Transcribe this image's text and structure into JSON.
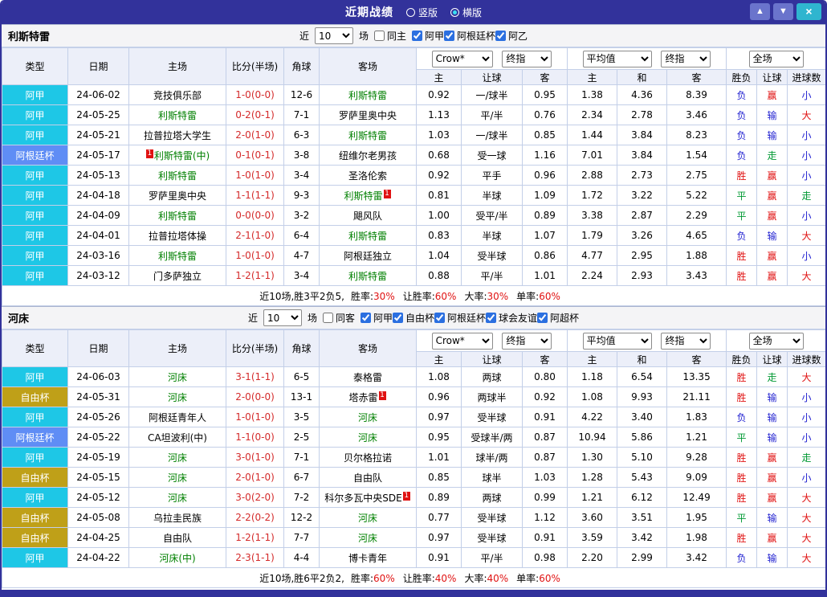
{
  "titlebar": {
    "title": "近期战绩",
    "layout_options": [
      {
        "label": "竖版",
        "selected": false
      },
      {
        "label": "横版",
        "selected": true
      }
    ],
    "up_icon": "▲",
    "down_icon": "▼",
    "close_icon": "×"
  },
  "filter_labels": {
    "recent": "近",
    "games": "场"
  },
  "columns": {
    "type": "类型",
    "date": "日期",
    "home": "主场",
    "score": "比分(半场)",
    "corner": "角球",
    "away": "客场",
    "odds_group1": {
      "select1": "Crow*",
      "select2": "终指",
      "sub": [
        "主",
        "让球",
        "客"
      ]
    },
    "odds_group2": {
      "select1": "平均值",
      "select2": "终指",
      "sub": [
        "主",
        "和",
        "客"
      ]
    },
    "result_group": {
      "select": "全场",
      "sub": [
        "胜负",
        "让球",
        "进球数"
      ]
    }
  },
  "league_colors": {
    "阿甲": "#1ec7e6",
    "阿根廷杯": "#5f8df5",
    "自由杯": "#bfa018"
  },
  "result_colors": {
    "胜": "#e01212",
    "赢": "#e01212",
    "大": "#e01212",
    "负": "#1f1fd0",
    "输": "#1f1fd0",
    "小": "#1f1fd0",
    "平": "#009933",
    "走": "#009933"
  },
  "sections": [
    {
      "team": "利斯特雷",
      "filter": {
        "count": "10",
        "same_label": "同主",
        "leagues": [
          "阿甲",
          "阿根廷杯",
          "阿乙"
        ]
      },
      "rows": [
        {
          "league": "阿甲",
          "date": "24-06-02",
          "home": {
            "name": "竞技俱乐部"
          },
          "score": "1-0(0-0)",
          "corner": "12-6",
          "away": {
            "name": "利斯特雷",
            "focus": true
          },
          "odds": [
            "0.92",
            "一/球半",
            "0.95"
          ],
          "avg": [
            "1.38",
            "4.36",
            "8.39"
          ],
          "results": [
            "负",
            "赢",
            "小"
          ]
        },
        {
          "league": "阿甲",
          "date": "24-05-25",
          "home": {
            "name": "利斯特雷",
            "focus": true
          },
          "score": "0-2(0-1)",
          "corner": "7-1",
          "away": {
            "name": "罗萨里奥中央"
          },
          "odds": [
            "1.13",
            "平/半",
            "0.76"
          ],
          "avg": [
            "2.34",
            "2.78",
            "3.46"
          ],
          "results": [
            "负",
            "输",
            "大"
          ]
        },
        {
          "league": "阿甲",
          "date": "24-05-21",
          "home": {
            "name": "拉普拉塔大学生"
          },
          "score": "2-0(1-0)",
          "corner": "6-3",
          "away": {
            "name": "利斯特雷",
            "focus": true
          },
          "odds": [
            "1.03",
            "一/球半",
            "0.85"
          ],
          "avg": [
            "1.44",
            "3.84",
            "8.23"
          ],
          "results": [
            "负",
            "输",
            "小"
          ]
        },
        {
          "league": "阿根廷杯",
          "date": "24-05-17",
          "home": {
            "name": "利斯特雷(中)",
            "focus": true,
            "badge": "1",
            "badge_pos": "before"
          },
          "score": "0-1(0-1)",
          "corner": "3-8",
          "away": {
            "name": "纽维尔老男孩"
          },
          "odds": [
            "0.68",
            "受一球",
            "1.16"
          ],
          "avg": [
            "7.01",
            "3.84",
            "1.54"
          ],
          "results": [
            "负",
            "走",
            "小"
          ]
        },
        {
          "league": "阿甲",
          "date": "24-05-13",
          "home": {
            "name": "利斯特雷",
            "focus": true
          },
          "score": "1-0(1-0)",
          "corner": "3-4",
          "away": {
            "name": "圣洛伦索"
          },
          "odds": [
            "0.92",
            "平手",
            "0.96"
          ],
          "avg": [
            "2.88",
            "2.73",
            "2.75"
          ],
          "results": [
            "胜",
            "赢",
            "小"
          ]
        },
        {
          "league": "阿甲",
          "date": "24-04-18",
          "home": {
            "name": "罗萨里奥中央"
          },
          "score": "1-1(1-1)",
          "corner": "9-3",
          "away": {
            "name": "利斯特雷",
            "focus": true,
            "badge": "1",
            "badge_pos": "after"
          },
          "odds": [
            "0.81",
            "半球",
            "1.09"
          ],
          "avg": [
            "1.72",
            "3.22",
            "5.22"
          ],
          "results": [
            "平",
            "赢",
            "走"
          ]
        },
        {
          "league": "阿甲",
          "date": "24-04-09",
          "home": {
            "name": "利斯特雷",
            "focus": true
          },
          "score": "0-0(0-0)",
          "corner": "3-2",
          "away": {
            "name": "飓风队"
          },
          "odds": [
            "1.00",
            "受平/半",
            "0.89"
          ],
          "avg": [
            "3.38",
            "2.87",
            "2.29"
          ],
          "results": [
            "平",
            "赢",
            "小"
          ]
        },
        {
          "league": "阿甲",
          "date": "24-04-01",
          "home": {
            "name": "拉普拉塔体操"
          },
          "score": "2-1(1-0)",
          "corner": "6-4",
          "away": {
            "name": "利斯特雷",
            "focus": true
          },
          "odds": [
            "0.83",
            "半球",
            "1.07"
          ],
          "avg": [
            "1.79",
            "3.26",
            "4.65"
          ],
          "results": [
            "负",
            "输",
            "大"
          ]
        },
        {
          "league": "阿甲",
          "date": "24-03-16",
          "home": {
            "name": "利斯特雷",
            "focus": true
          },
          "score": "1-0(1-0)",
          "corner": "4-7",
          "away": {
            "name": "阿根廷独立"
          },
          "odds": [
            "1.04",
            "受半球",
            "0.86"
          ],
          "avg": [
            "4.77",
            "2.95",
            "1.88"
          ],
          "results": [
            "胜",
            "赢",
            "小"
          ]
        },
        {
          "league": "阿甲",
          "date": "24-03-12",
          "home": {
            "name": "门多萨独立"
          },
          "score": "1-2(1-1)",
          "corner": "3-4",
          "away": {
            "name": "利斯特雷",
            "focus": true
          },
          "odds": [
            "0.88",
            "平/半",
            "1.01"
          ],
          "avg": [
            "2.24",
            "2.93",
            "3.43"
          ],
          "results": [
            "胜",
            "赢",
            "大"
          ]
        }
      ],
      "summary": {
        "prefix": "近10场,胜3平2负5,",
        "stats": [
          {
            "label": "胜率:",
            "value": "30%"
          },
          {
            "label": "让胜率:",
            "value": "60%"
          },
          {
            "label": "大率:",
            "value": "30%"
          },
          {
            "label": "单率:",
            "value": "60%"
          }
        ]
      }
    },
    {
      "team": "河床",
      "filter": {
        "count": "10",
        "same_label": "同客",
        "leagues": [
          "阿甲",
          "自由杯",
          "阿根廷杯",
          "球会友谊",
          "阿超杯"
        ]
      },
      "rows": [
        {
          "league": "阿甲",
          "date": "24-06-03",
          "home": {
            "name": "河床",
            "focus": true
          },
          "score": "3-1(1-1)",
          "corner": "6-5",
          "away": {
            "name": "泰格雷"
          },
          "odds": [
            "1.08",
            "两球",
            "0.80"
          ],
          "avg": [
            "1.18",
            "6.54",
            "13.35"
          ],
          "results": [
            "胜",
            "走",
            "大"
          ]
        },
        {
          "league": "自由杯",
          "date": "24-05-31",
          "home": {
            "name": "河床",
            "focus": true
          },
          "score": "2-0(0-0)",
          "corner": "13-1",
          "away": {
            "name": "塔赤雷",
            "badge": "1",
            "badge_pos": "after"
          },
          "odds": [
            "0.96",
            "两球半",
            "0.92"
          ],
          "avg": [
            "1.08",
            "9.93",
            "21.11"
          ],
          "results": [
            "胜",
            "输",
            "小"
          ]
        },
        {
          "league": "阿甲",
          "date": "24-05-26",
          "home": {
            "name": "阿根廷青年人"
          },
          "score": "1-0(1-0)",
          "corner": "3-5",
          "away": {
            "name": "河床",
            "focus": true
          },
          "odds": [
            "0.97",
            "受半球",
            "0.91"
          ],
          "avg": [
            "4.22",
            "3.40",
            "1.83"
          ],
          "results": [
            "负",
            "输",
            "小"
          ]
        },
        {
          "league": "阿根廷杯",
          "date": "24-05-22",
          "home": {
            "name": "CA坦波利(中)"
          },
          "score": "1-1(0-0)",
          "corner": "2-5",
          "away": {
            "name": "河床",
            "focus": true
          },
          "odds": [
            "0.95",
            "受球半/两",
            "0.87"
          ],
          "avg": [
            "10.94",
            "5.86",
            "1.21"
          ],
          "results": [
            "平",
            "输",
            "小"
          ]
        },
        {
          "league": "阿甲",
          "date": "24-05-19",
          "home": {
            "name": "河床",
            "focus": true
          },
          "score": "3-0(1-0)",
          "corner": "7-1",
          "away": {
            "name": "贝尔格拉诺"
          },
          "odds": [
            "1.01",
            "球半/两",
            "0.87"
          ],
          "avg": [
            "1.30",
            "5.10",
            "9.28"
          ],
          "results": [
            "胜",
            "赢",
            "走"
          ]
        },
        {
          "league": "自由杯",
          "date": "24-05-15",
          "home": {
            "name": "河床",
            "focus": true
          },
          "score": "2-0(1-0)",
          "corner": "6-7",
          "away": {
            "name": "自由队"
          },
          "odds": [
            "0.85",
            "球半",
            "1.03"
          ],
          "avg": [
            "1.28",
            "5.43",
            "9.09"
          ],
          "results": [
            "胜",
            "赢",
            "小"
          ]
        },
        {
          "league": "阿甲",
          "date": "24-05-12",
          "home": {
            "name": "河床",
            "focus": true
          },
          "score": "3-0(2-0)",
          "corner": "7-2",
          "away": {
            "name": "科尔多瓦中央SDE",
            "badge": "1",
            "badge_pos": "after"
          },
          "odds": [
            "0.89",
            "两球",
            "0.99"
          ],
          "avg": [
            "1.21",
            "6.12",
            "12.49"
          ],
          "results": [
            "胜",
            "赢",
            "大"
          ]
        },
        {
          "league": "自由杯",
          "date": "24-05-08",
          "home": {
            "name": "乌拉圭民族"
          },
          "score": "2-2(0-2)",
          "corner": "12-2",
          "away": {
            "name": "河床",
            "focus": true
          },
          "odds": [
            "0.77",
            "受半球",
            "1.12"
          ],
          "avg": [
            "3.60",
            "3.51",
            "1.95"
          ],
          "results": [
            "平",
            "输",
            "大"
          ]
        },
        {
          "league": "自由杯",
          "date": "24-04-25",
          "home": {
            "name": "自由队"
          },
          "score": "1-2(1-1)",
          "corner": "7-7",
          "away": {
            "name": "河床",
            "focus": true
          },
          "odds": [
            "0.97",
            "受半球",
            "0.91"
          ],
          "avg": [
            "3.59",
            "3.42",
            "1.98"
          ],
          "results": [
            "胜",
            "赢",
            "大"
          ]
        },
        {
          "league": "阿甲",
          "date": "24-04-22",
          "home": {
            "name": "河床(中)",
            "focus": true
          },
          "score": "2-3(1-1)",
          "corner": "4-4",
          "away": {
            "name": "博卡青年"
          },
          "odds": [
            "0.91",
            "平/半",
            "0.98"
          ],
          "avg": [
            "2.20",
            "2.99",
            "3.42"
          ],
          "results": [
            "负",
            "输",
            "大"
          ]
        }
      ],
      "summary": {
        "prefix": "近10场,胜6平2负2,",
        "stats": [
          {
            "label": "胜率:",
            "value": "60%"
          },
          {
            "label": "让胜率:",
            "value": "40%"
          },
          {
            "label": "大率:",
            "value": "40%"
          },
          {
            "label": "单率:",
            "value": "60%"
          }
        ]
      }
    }
  ]
}
